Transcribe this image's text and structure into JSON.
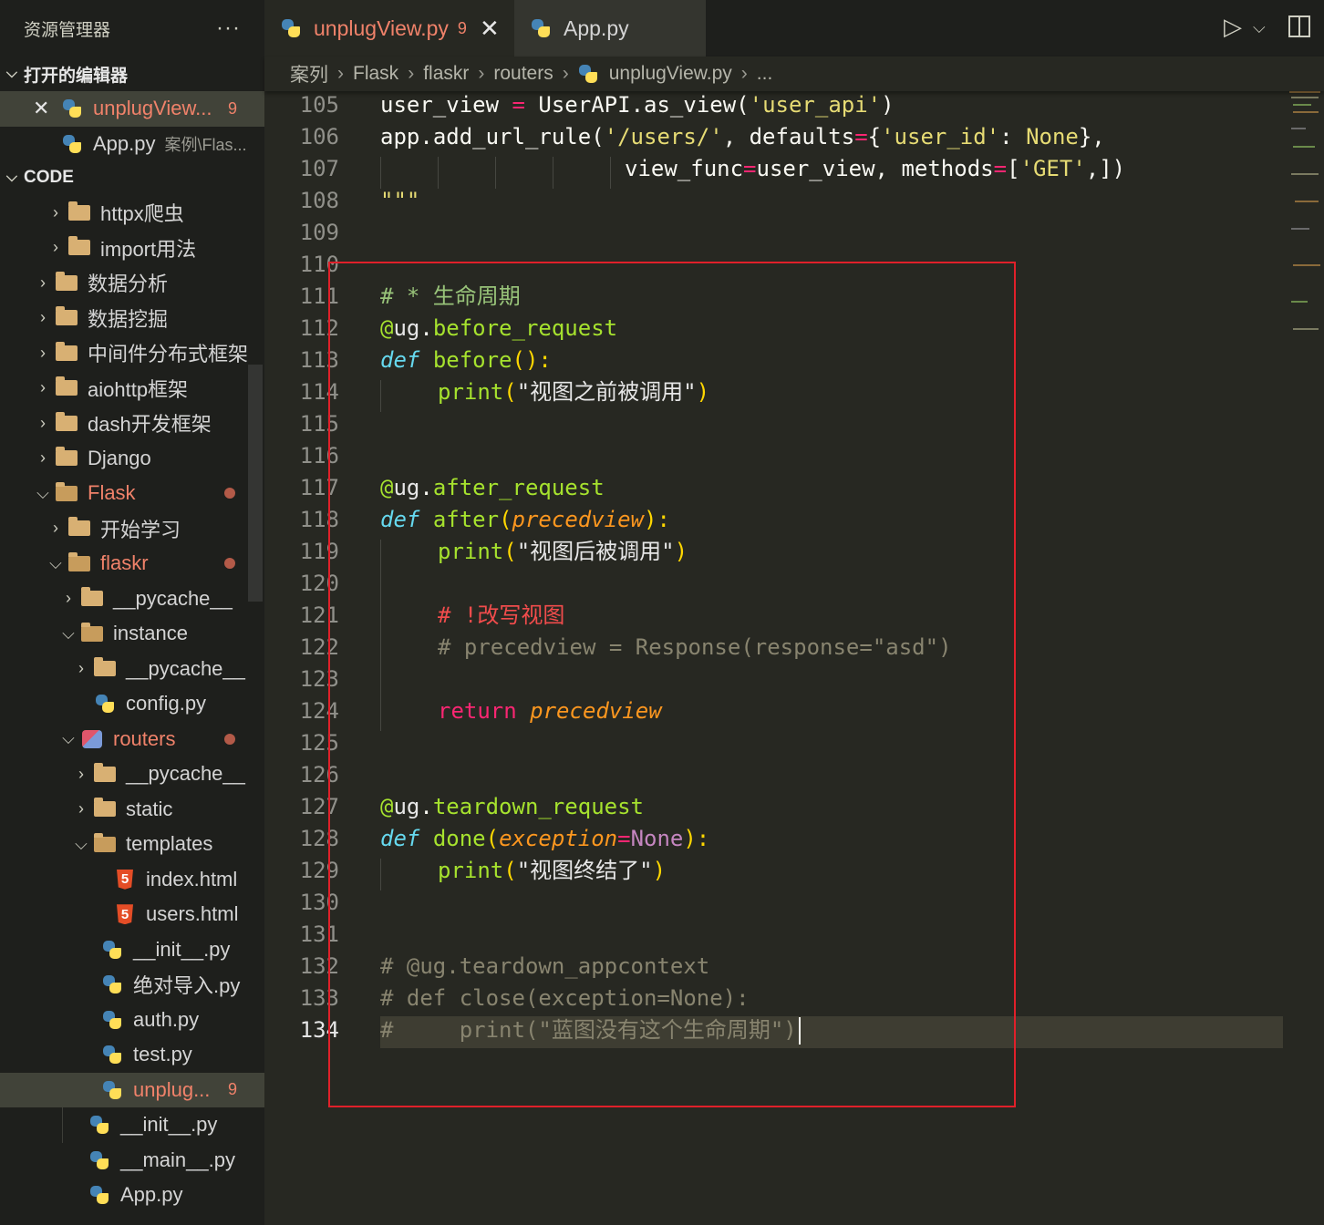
{
  "sidebar": {
    "title": "资源管理器",
    "more_label": "···",
    "open_editors_label": "打开的编辑器",
    "open_editors": [
      {
        "name": "unplugView...",
        "badge": "9",
        "modified": true
      },
      {
        "name": "App.py",
        "path": "案例\\Flas..."
      }
    ],
    "workspace_label": "CODE",
    "tree": [
      "httpx爬虫",
      "import用法",
      "数据分析",
      "数据挖掘",
      "中间件分布式框架",
      "aiohttp框架",
      "dash开发框架",
      "Django",
      "Flask",
      "开始学习",
      "flaskr",
      "__pycache__",
      "instance",
      "__pycache__",
      "config.py",
      "routers",
      "__pycache__",
      "static",
      "templates",
      "index.html",
      "users.html",
      "__init__.py",
      "绝对导入.py",
      "auth.py",
      "test.py",
      "unplug...",
      "__init__.py",
      "__main__.py",
      "App.py"
    ],
    "selected_badge": "9"
  },
  "tabs": [
    {
      "label": "unplugView.py",
      "badge": "9",
      "active": true,
      "close": "✕"
    },
    {
      "label": "App.py",
      "active": false
    }
  ],
  "breadcrumb": [
    "案列",
    "Flask",
    "flaskr",
    "routers",
    "unplugView.py",
    "..."
  ],
  "editor": {
    "line_numbers": [
      "105",
      "106",
      "107",
      "108",
      "109",
      "110",
      "111",
      "112",
      "113",
      "114",
      "115",
      "116",
      "117",
      "118",
      "119",
      "120",
      "121",
      "122",
      "123",
      "124",
      "125",
      "126",
      "127",
      "128",
      "129",
      "130",
      "131",
      "132",
      "133",
      "134"
    ],
    "current_line": "134",
    "lines": {
      "l105a": "user_view",
      "l105b": " = ",
      "l105c": "UserAPI",
      "l105d": ".",
      "l105e": "as_view",
      "l105f": "(",
      "l105g": "'user_api'",
      "l105h": ")",
      "l106a": "app",
      "l106b": ".",
      "l106c": "add_url_rule",
      "l106d": "(",
      "l106e": "'/users/'",
      "l106f": ", ",
      "l106g": "defaults",
      "l106h": "=",
      "l106i": "{",
      "l106j": "'user_id'",
      "l106k": ": ",
      "l106l": "None",
      "l106m": "},",
      "l107a": "view_func",
      "l107b": "=",
      "l107c": "user_view",
      "l107d": ", ",
      "l107e": "methods",
      "l107f": "=",
      "l107g": "[",
      "l107h": "'GET'",
      "l107i": ",])",
      "l108": "\"\"\"",
      "l111a": "# * ",
      "l111b": "生命周期",
      "l112a": "@",
      "l112b": "ug",
      "l112c": ".",
      "l112d": "before_request",
      "l113a": "def",
      "l113b": " ",
      "l113c": "before",
      "l113d": "():",
      "l114a": "print",
      "l114b": "(",
      "l114c": "\"视图之前被调用\"",
      "l114d": ")",
      "l117a": "@",
      "l117b": "ug",
      "l117c": ".",
      "l117d": "after_request",
      "l118a": "def",
      "l118b": " ",
      "l118c": "after",
      "l118d": "(",
      "l118e": "precedview",
      "l118f": "):",
      "l119a": "print",
      "l119b": "(",
      "l119c": "\"视图后被调用\"",
      "l119d": ")",
      "l121": "# !改写视图",
      "l122": "# precedview = Response(response=\"asd\")",
      "l124a": "return",
      "l124b": " ",
      "l124c": "precedview",
      "l127a": "@",
      "l127b": "ug",
      "l127c": ".",
      "l127d": "teardown_request",
      "l128a": "def",
      "l128b": " ",
      "l128c": "done",
      "l128d": "(",
      "l128e": "exception",
      "l128f": "=",
      "l128g": "None",
      "l128h": "):",
      "l129a": "print",
      "l129b": "(",
      "l129c": "\"视图终结了\"",
      "l129d": ")",
      "l132": "# @ug.teardown_appcontext",
      "l133": "# def close(exception=None):",
      "l134": "#     print(\"蓝图没有这个生命周期\")"
    }
  },
  "colors": {
    "editor_bg": "#272822",
    "sidebar_bg": "#1e1f1c",
    "modified": "#f0826a",
    "highlight_box": "#e0202a"
  },
  "icons": [
    "python-icon",
    "folder-icon",
    "html5-icon",
    "chevron-right-icon",
    "chevron-down-icon",
    "close-icon",
    "run-icon",
    "split-editor-icon"
  ]
}
